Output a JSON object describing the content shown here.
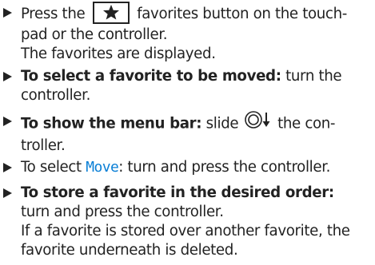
{
  "steps": [
    {
      "lines": [
        [
          "Press the ",
          "",
          " favorites button on the touch-"
        ],
        [
          "pad or the controller."
        ]
      ],
      "result": "The favorites are displayed.",
      "icon": "star-icon"
    },
    {
      "bold": "To select a favorite to be moved:",
      "rest1": " turn the",
      "line2": "controller."
    },
    {
      "bold": "To show the menu bar:",
      "rest1a": " slide ",
      "rest1b": " the con-",
      "line2": "troller.",
      "icon": "slide-down-icon"
    },
    {
      "pre": "To select ",
      "term": "Move",
      "post": ": turn and press the controller."
    },
    {
      "bold": "To store a favorite in the desired order:",
      "line2": "turn and press the controller.",
      "result1": "If a favorite is stored over another favorite, the",
      "result2": "favorite underneath is deleted."
    }
  ],
  "colors": {
    "text": "#222222",
    "menu_term": "#0a7fd6"
  }
}
